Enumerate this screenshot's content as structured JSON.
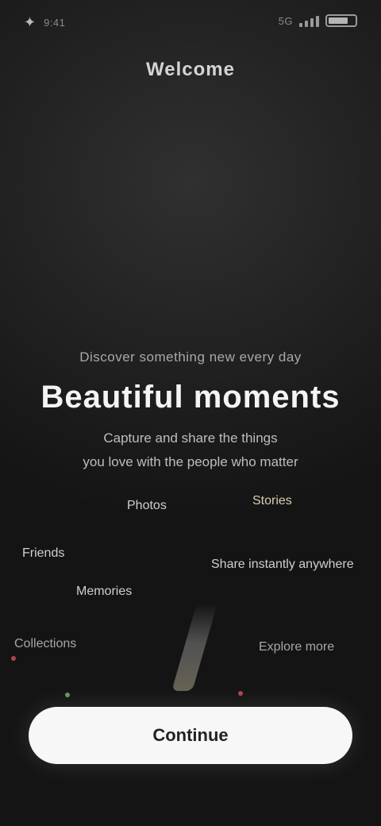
{
  "status_bar": {
    "left_glyph": "✦",
    "left_text": "9:41",
    "right_text": "5G"
  },
  "header": {
    "title": "Welcome"
  },
  "hero": {
    "eyebrow": "Discover something new every day",
    "headline": "Beautiful moments",
    "description_line1": "Capture and share the things",
    "description_line2": "you love with the people who matter"
  },
  "floating_labels": [
    "Photos",
    "Stories",
    "Friends",
    "Share instantly anywhere",
    "Memories",
    "Collections",
    "Explore more"
  ],
  "cta": {
    "label": "Continue"
  },
  "colors": {
    "background": "#151515",
    "cta_background": "#f7f7f7",
    "accent_red": "#b0444a",
    "accent_green": "#5d9a63"
  }
}
